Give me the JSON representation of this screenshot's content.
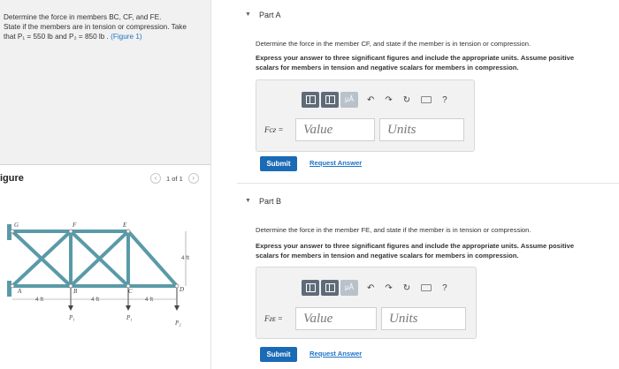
{
  "problem": {
    "line1": "Determine the force in members BC, CF, and FE.",
    "line2": "State if the members are in tension or compression. Take",
    "line3_prefix": "that P₁ = 550 lb and P₂ = 850 lb .",
    "figure_link": "(Figure 1)"
  },
  "figure": {
    "label": "igure",
    "pager_text": "1 of 1",
    "prev_icon": "chevron-left-icon",
    "next_icon": "chevron-right-icon",
    "joints": [
      "G",
      "F",
      "E",
      "A",
      "B",
      "C",
      "D"
    ],
    "spacing_label": "4 ft",
    "loads": [
      "P₁",
      "P₁",
      "P₂"
    ]
  },
  "partA": {
    "title": "Part A",
    "question": "Determine the force in the member CF, and state if the member is in tension or compression.",
    "instruction1": "Express your answer to three significant figures and include the appropriate units. Assume positive",
    "instruction2": "scalars for members in tension and negative scalars for members in compression.",
    "field_label": "Fᴄғ =",
    "value_placeholder": "Value",
    "units_placeholder": "Units",
    "submit": "Submit",
    "request": "Request Answer"
  },
  "partB": {
    "title": "Part B",
    "question": "Determine the force in the member FE, and state if the member is in tension or compression.",
    "instruction1": "Express your answer to three significant figures and include the appropriate units. Assume positive",
    "instruction2": "scalars for members in tension and negative scalars for members in compression.",
    "field_label": "Fғᴇ =",
    "value_placeholder": "Value",
    "units_placeholder": "Units",
    "submit": "Submit",
    "request": "Request Answer"
  },
  "toolbar": {
    "mu_label": "μÅ",
    "help": "?",
    "icons": [
      "templates-icon",
      "symbols-icon",
      "undo-icon",
      "redo-icon",
      "reset-icon",
      "keyboard-icon",
      "help-icon"
    ]
  },
  "colors": {
    "accent": "#1a6ab5",
    "link": "#1f73c6",
    "panel": "#f1f1f1",
    "truss": "#5a9aa8"
  }
}
